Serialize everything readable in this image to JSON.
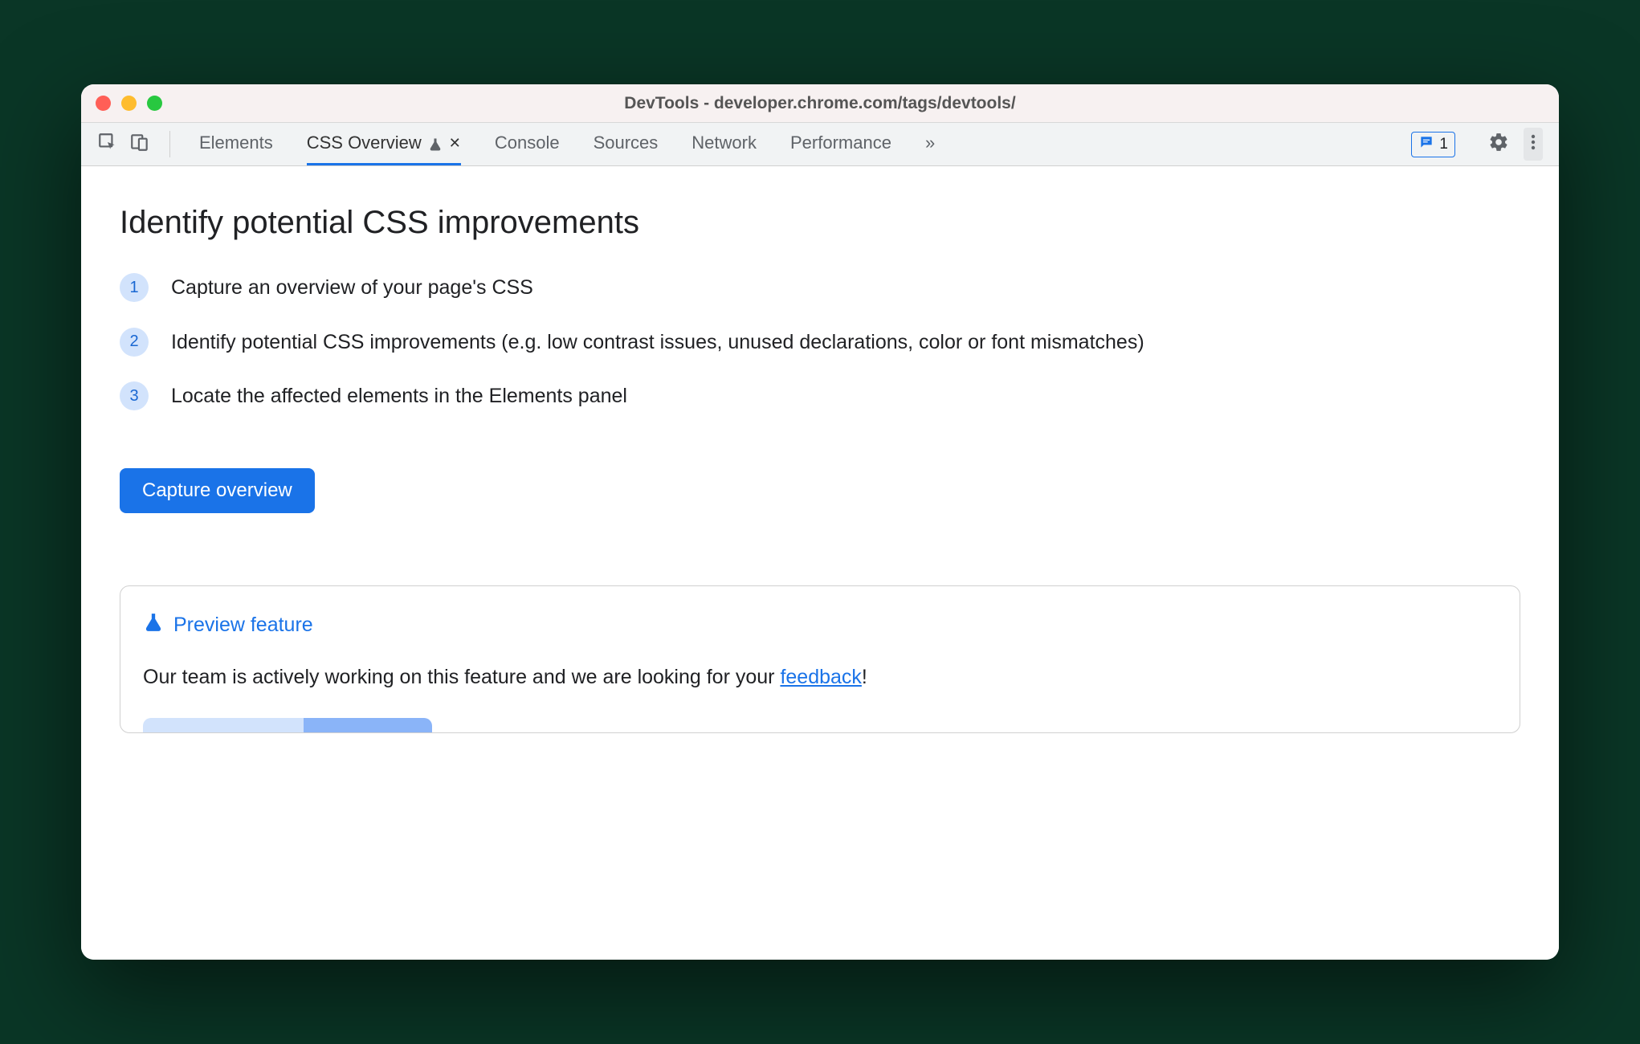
{
  "window": {
    "title": "DevTools - developer.chrome.com/tags/devtools/"
  },
  "tabs": {
    "items": [
      {
        "label": "Elements"
      },
      {
        "label": "CSS Overview",
        "active": true,
        "experimental": true,
        "closable": true
      },
      {
        "label": "Console"
      },
      {
        "label": "Sources"
      },
      {
        "label": "Network"
      },
      {
        "label": "Performance"
      }
    ]
  },
  "toolbar": {
    "issues_count": "1",
    "more_label": "»"
  },
  "main": {
    "heading": "Identify potential CSS improvements",
    "steps": [
      "Capture an overview of your page's CSS",
      "Identify potential CSS improvements (e.g. low contrast issues, unused declarations, color or font mismatches)",
      "Locate the affected elements in the Elements panel"
    ],
    "step_numbers": [
      "1",
      "2",
      "3"
    ],
    "capture_button": "Capture overview"
  },
  "preview": {
    "title": "Preview feature",
    "body_prefix": "Our team is actively working on this feature and we are looking for your ",
    "link_text": "feedback",
    "body_suffix": "!"
  }
}
